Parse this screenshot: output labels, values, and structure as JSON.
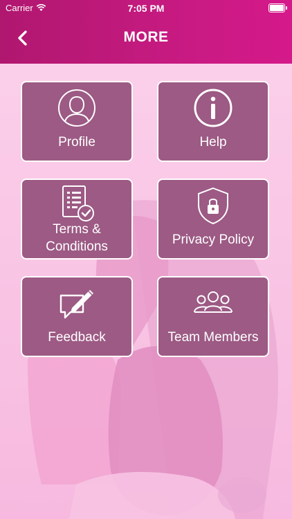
{
  "status_bar": {
    "carrier": "Carrier",
    "time": "7:05 PM"
  },
  "header": {
    "title": "MORE",
    "back_icon": "chevron-left-icon"
  },
  "tiles": [
    {
      "label": "Profile",
      "icon": "user-icon"
    },
    {
      "label": "Help",
      "icon": "info-icon"
    },
    {
      "label": "Terms & Conditions",
      "icon": "document-check-icon"
    },
    {
      "label": "Privacy Policy",
      "icon": "shield-lock-icon"
    },
    {
      "label": "Feedback",
      "icon": "feedback-pen-icon"
    },
    {
      "label": "Team Members",
      "icon": "team-icon"
    }
  ],
  "colors": {
    "header_start": "#b0176f",
    "header_end": "#d5198a",
    "tile": "#9c5a84",
    "background": "#f9c6e6"
  }
}
